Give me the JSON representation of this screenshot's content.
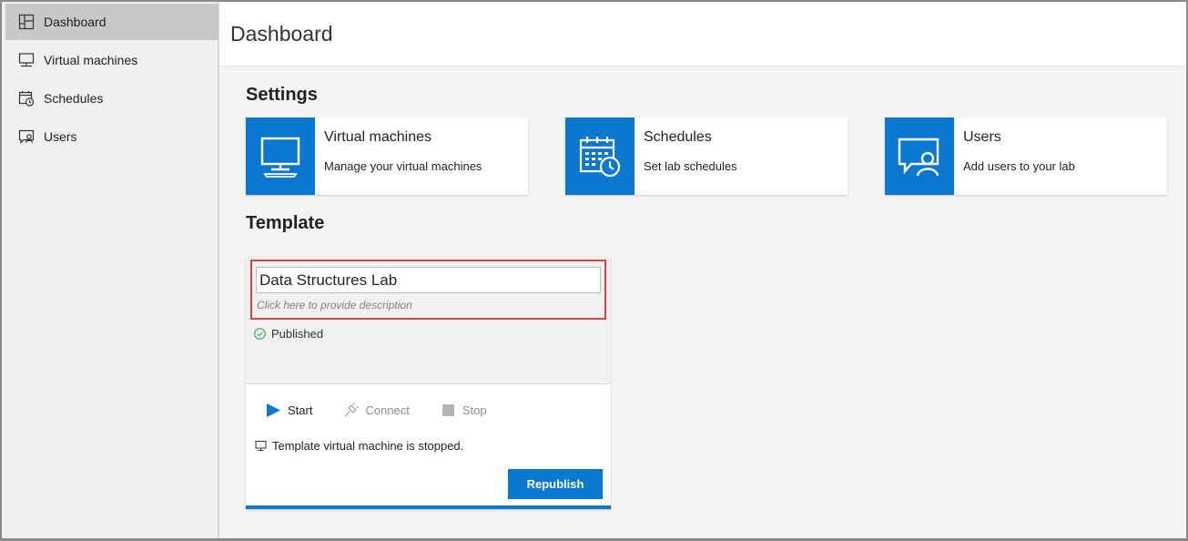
{
  "sidebar": {
    "items": [
      {
        "label": "Dashboard",
        "icon": "dashboard-icon",
        "active": true
      },
      {
        "label": "Virtual machines",
        "icon": "monitor-icon",
        "active": false
      },
      {
        "label": "Schedules",
        "icon": "calendar-clock-icon",
        "active": false
      },
      {
        "label": "Users",
        "icon": "users-icon",
        "active": false
      }
    ]
  },
  "header": {
    "title": "Dashboard"
  },
  "settings": {
    "title": "Settings",
    "cards": [
      {
        "title": "Virtual machines",
        "description": "Manage your virtual machines",
        "icon": "monitor-icon"
      },
      {
        "title": "Schedules",
        "description": "Set lab schedules",
        "icon": "calendar-clock-icon"
      },
      {
        "title": "Users",
        "description": "Add users to your lab",
        "icon": "users-icon"
      }
    ]
  },
  "template": {
    "title": "Template",
    "name_value": "Data Structures Lab",
    "description_placeholder": "Click here to provide description",
    "status": "Published",
    "actions": {
      "start": "Start",
      "connect": "Connect",
      "stop": "Stop"
    },
    "vm_status": "Template virtual machine is stopped.",
    "republish_label": "Republish"
  },
  "colors": {
    "accent": "#0a78d1",
    "highlight": "#d64545",
    "published": "#3aa35c"
  }
}
